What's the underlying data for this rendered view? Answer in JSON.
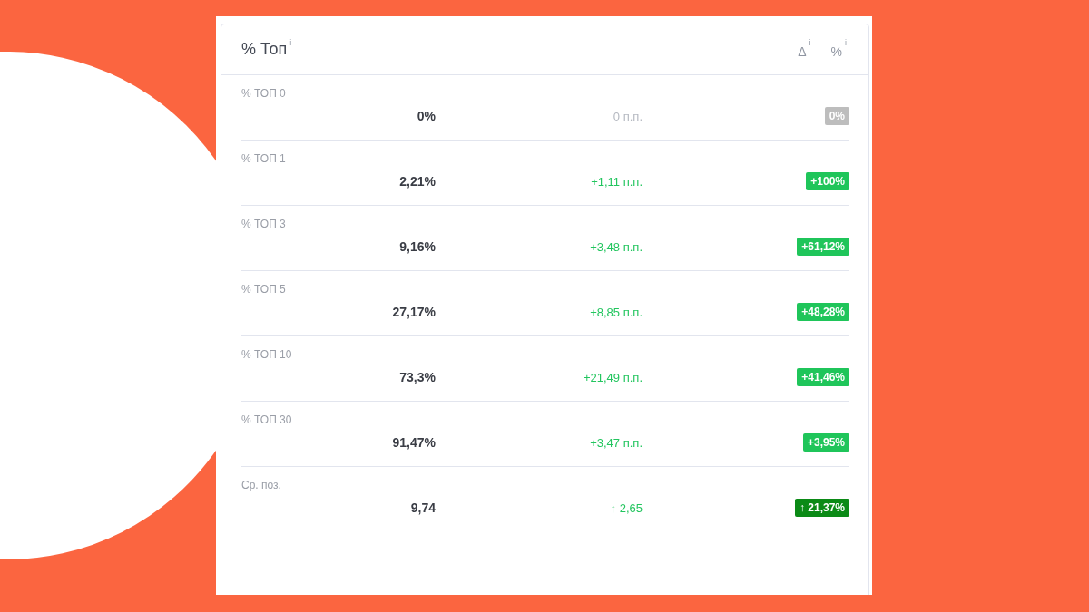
{
  "panel": {
    "title": "% Топ",
    "title_hint": "i",
    "columns": [
      {
        "label": "Δ",
        "hint": "i"
      },
      {
        "label": "%",
        "hint": "i"
      }
    ]
  },
  "rows": [
    {
      "label": "% ТОП 0",
      "value": "0%",
      "delta": {
        "text": "0 п.п.",
        "color": "#b5b9c1"
      },
      "badge": {
        "text": "0%",
        "color": "#bdbdbd"
      }
    },
    {
      "label": "% ТОП 1",
      "value": "2,21%",
      "delta": {
        "text": "+1,11 п.п.",
        "color": "#22c55e"
      },
      "badge": {
        "text": "+100%",
        "color": "#1fc55a"
      }
    },
    {
      "label": "% ТОП 3",
      "value": "9,16%",
      "delta": {
        "text": "+3,48 п.п.",
        "color": "#22c55e"
      },
      "badge": {
        "text": "+61,12%",
        "color": "#1fc55a"
      }
    },
    {
      "label": "% ТОП 5",
      "value": "27,17%",
      "delta": {
        "text": "+8,85 п.п.",
        "color": "#22c55e"
      },
      "badge": {
        "text": "+48,28%",
        "color": "#1fc55a"
      }
    },
    {
      "label": "% ТОП 10",
      "value": "73,3%",
      "delta": {
        "text": "+21,49 п.п.",
        "color": "#22c55e"
      },
      "badge": {
        "text": "+41,46%",
        "color": "#1fc55a"
      }
    },
    {
      "label": "% ТОП 30",
      "value": "91,47%",
      "delta": {
        "text": "+3,47 п.п.",
        "color": "#22c55e"
      },
      "badge": {
        "text": "+3,95%",
        "color": "#1fc55a"
      }
    },
    {
      "label": "Ср. поз.",
      "value": "9,74",
      "delta": {
        "text": "↑ 2,65",
        "color": "#22c55e"
      },
      "badge": {
        "text": "↑ 21,37%",
        "color": "#0b8a16"
      }
    }
  ]
}
